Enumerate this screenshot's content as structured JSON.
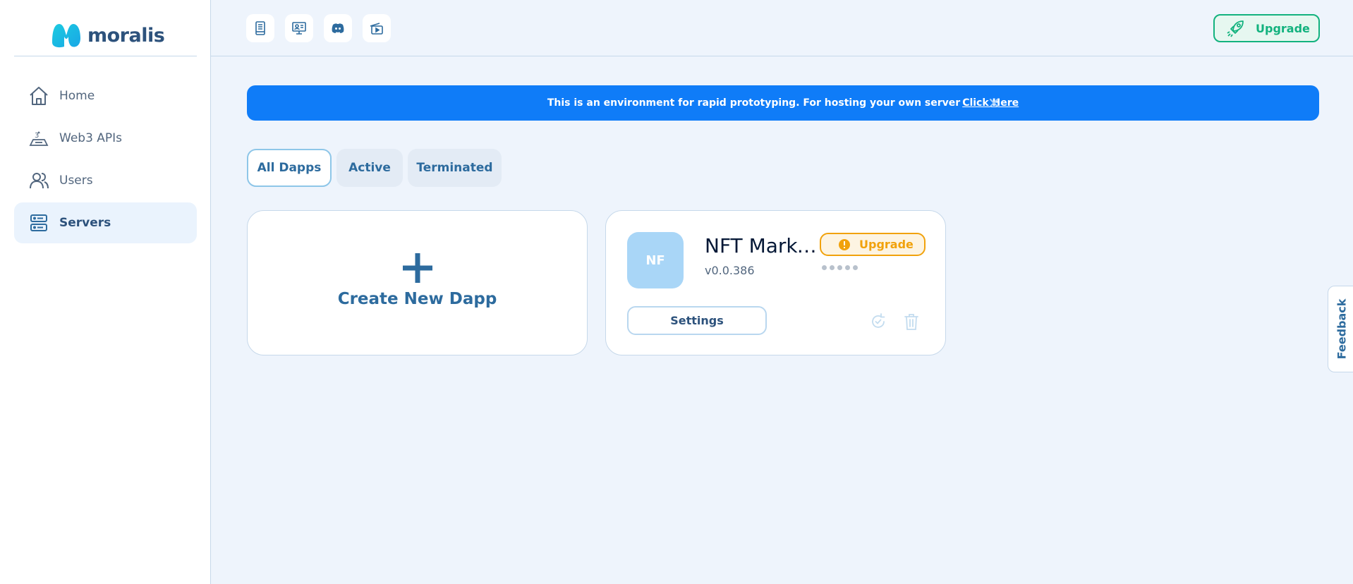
{
  "brand": {
    "name": "moralis",
    "logo_color": "#1ccbe0"
  },
  "sidebar": {
    "items": [
      {
        "label": "Home",
        "icon": "home-icon",
        "active": false
      },
      {
        "label": "Web3 APIs",
        "icon": "web3-apis-icon",
        "active": false
      },
      {
        "label": "Users",
        "icon": "users-icon",
        "active": false
      },
      {
        "label": "Servers",
        "icon": "servers-icon",
        "active": true
      }
    ]
  },
  "topbar": {
    "icons": [
      "docs-icon",
      "tutorials-icon",
      "discord-icon",
      "video-icon"
    ],
    "upgrade_label": "Upgrade",
    "upgrade_color": "#13b27e"
  },
  "banner": {
    "text": "This is an environment for rapid prototyping. For hosting your own server",
    "link": "Click Here",
    "color": "#0f7cf8"
  },
  "tabs": [
    {
      "label": "All Dapps",
      "active": true
    },
    {
      "label": "Active",
      "active": false
    },
    {
      "label": "Terminated",
      "active": false
    }
  ],
  "create_card": {
    "label": "Create New Dapp"
  },
  "dapp": {
    "initials": "NF",
    "name": "NFT Marketplace",
    "version": "v0.0.386",
    "upgrade_label": "Upgrade",
    "upgrade_color": "#f1a20c",
    "settings_label": "Settings"
  },
  "feedback": {
    "label": "Feedback"
  }
}
